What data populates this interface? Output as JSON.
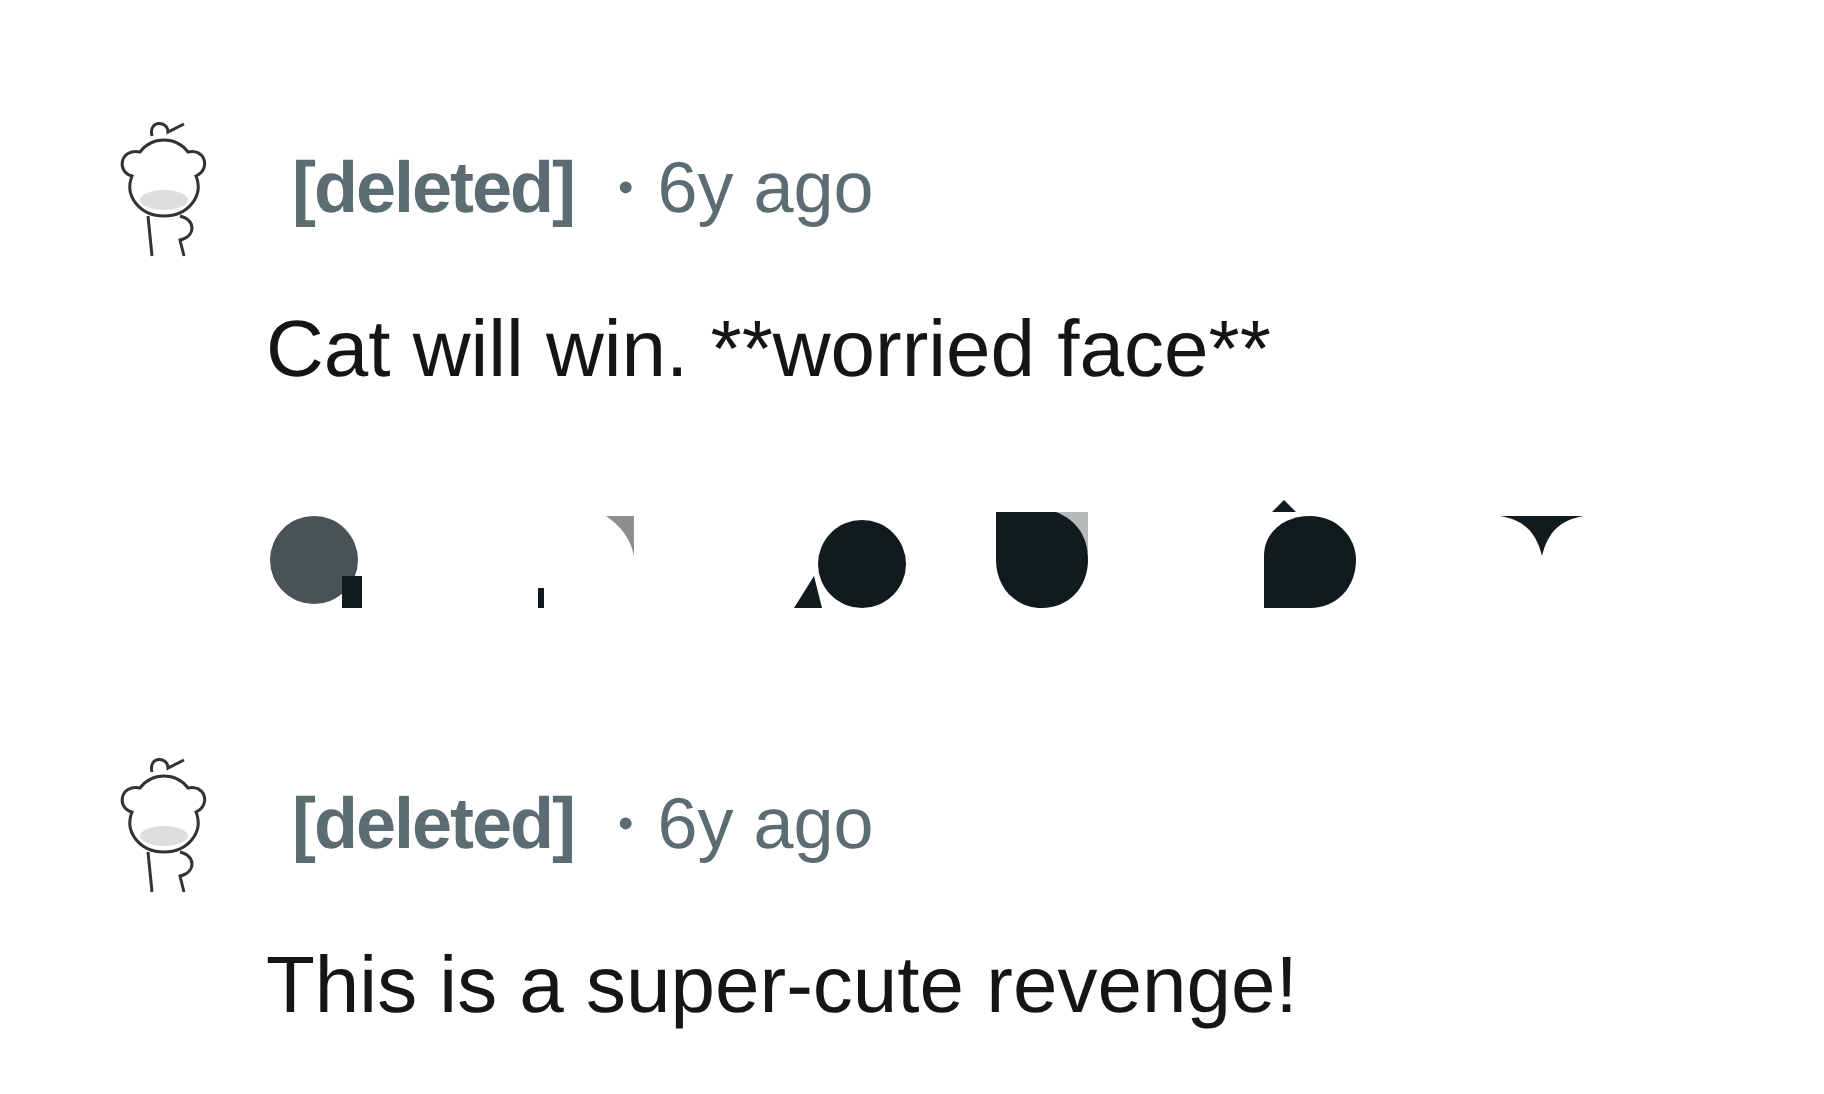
{
  "comments": [
    {
      "author": "[deleted]",
      "separator": "•",
      "age": "6y ago",
      "body": "Cat will win. **worried face**",
      "actions": [
        {
          "kind": "grey-dot"
        },
        {
          "kind": "corner"
        },
        {
          "kind": "dot-notch"
        },
        {
          "kind": "dot-square"
        },
        {
          "kind": "dot-peak"
        },
        {
          "kind": "wedge"
        }
      ]
    },
    {
      "author": "[deleted]",
      "separator": "•",
      "age": "6y ago",
      "body": "This is a super-cute revenge!"
    }
  ]
}
